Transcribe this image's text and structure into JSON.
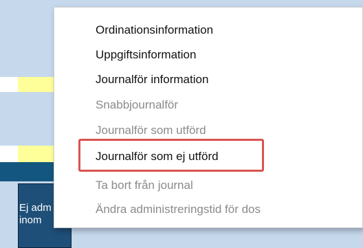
{
  "background": {
    "tile_text_line1": "Ej adm",
    "tile_text_line2": "inom"
  },
  "context_menu": {
    "items": [
      {
        "label": "Ordinationsinformation",
        "enabled": true
      },
      {
        "label": "Uppgiftsinformation",
        "enabled": true
      },
      {
        "label": "Journalför information",
        "enabled": true
      },
      {
        "label": "Snabbjournalför",
        "enabled": false
      },
      {
        "label": "Journalför som utförd",
        "enabled": false
      },
      {
        "label": "Journalför som ej utförd",
        "enabled": true,
        "highlighted": true
      },
      {
        "label": "Ta bort från journal",
        "enabled": false
      },
      {
        "label": "Ändra administreringstid för dos",
        "enabled": false
      }
    ]
  },
  "colors": {
    "panel_light_blue": "#c6d8ec",
    "panel_dark_blue": "#13567f",
    "row_yellow": "#ffff99",
    "highlight_border": "#d9534f",
    "disabled_text": "#8a8a8a"
  }
}
